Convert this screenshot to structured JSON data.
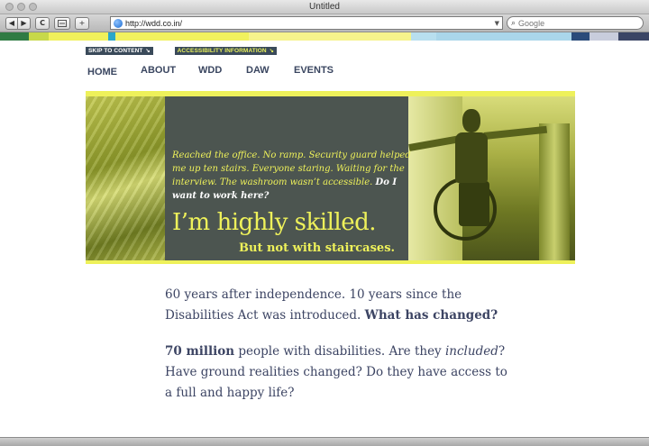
{
  "browser": {
    "window_title": "Untitled",
    "url": "http://wdd.co.in/",
    "search_placeholder": "Google",
    "back_icon": "◀",
    "forward_icon": "▶",
    "reload_icon": "C",
    "add_icon": "+"
  },
  "color_strip": [
    "#2f7b43",
    "#c7d84a",
    "#f0f05b",
    "#2aa7c9",
    "#f1f15e",
    "#f6f38c",
    "#b8dfef",
    "#aad6ea",
    "#2a4b7a",
    "#c8cddc",
    "#3a4565"
  ],
  "skip_links": {
    "skip_to_content": "SKIP TO CONTENT",
    "accessibility": "ACCESSIBILITY INFORMATION"
  },
  "nav": {
    "home": "HOME",
    "about": "ABOUT",
    "wdd": "WDD",
    "daw": "DAW",
    "events": "EVENTS"
  },
  "banner": {
    "story": "Reached the office. No ramp. Security guard helped me up ten stairs. Everyone staring. Waiting for the interview. The washroom wasn’t accessible.",
    "question": "Do I want to work here?",
    "headline": "I’m highly skilled.",
    "subline": "But not with staircases."
  },
  "content": {
    "p1_text": "60 years after independence. 10 years since the Disabilities Act was introduced.",
    "p1_bold": "What has changed?",
    "p2_bold": "70 million",
    "p2_text_a": "people with disabilities. Are they",
    "p2_italic": "included",
    "p2_text_b": "? Have ground realities changed? Do they have access to a full and happy life?"
  }
}
